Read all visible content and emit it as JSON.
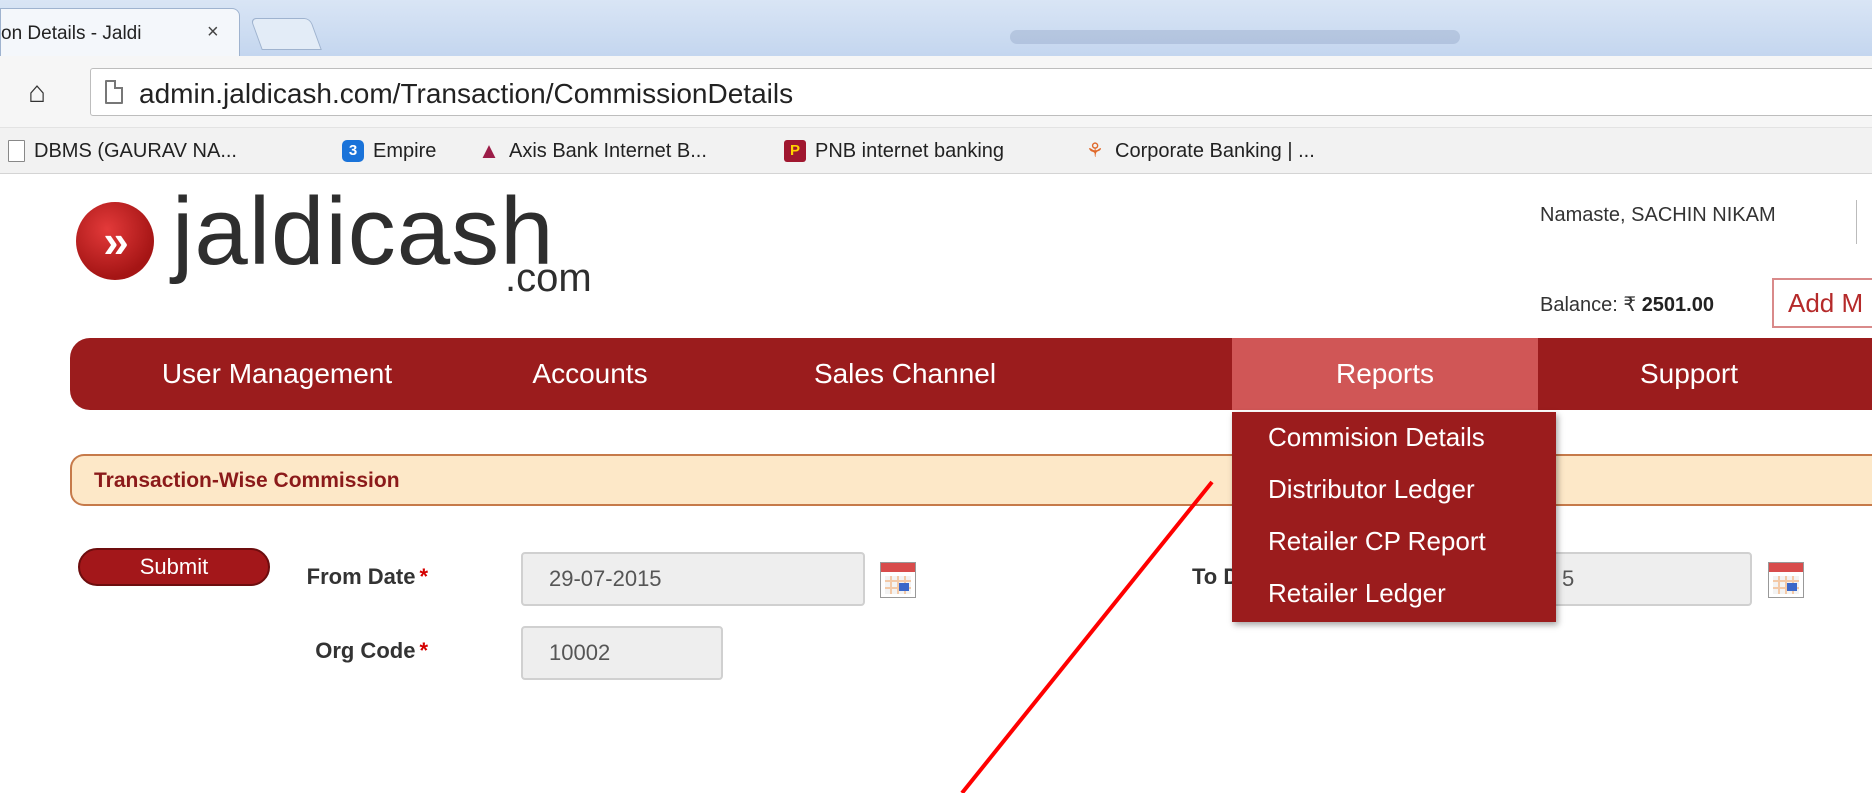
{
  "browser": {
    "tab_title": "on Details - Jaldi",
    "tab_close": "×",
    "url": "admin.jaldicash.com/Transaction/CommissionDetails",
    "bookmarks": [
      {
        "label": "DBMS (GAURAV NA...",
        "icon": "page-icon"
      },
      {
        "label": "Empire",
        "icon": "empire-icon",
        "glyph": "3"
      },
      {
        "label": "Axis Bank Internet B...",
        "icon": "axis-bank-icon",
        "glyph": "▲"
      },
      {
        "label": "PNB internet banking",
        "icon": "pnb-icon",
        "glyph": "P"
      },
      {
        "label": "Corporate Banking | ...",
        "icon": "icici-icon",
        "glyph": "⚘"
      }
    ]
  },
  "header": {
    "logo_text": "jaldicash",
    "logo_suffix": ".com",
    "logo_glyph": "»",
    "greeting": "Namaste, SACHIN NIKAM",
    "balance_label": "Balance: ₹",
    "balance_value": "2501.00",
    "add_money_label": "Add M"
  },
  "nav": {
    "items": [
      "User Management",
      "Accounts",
      "Sales Channel",
      "Reports",
      "Support"
    ],
    "active": "Reports",
    "reports_menu": [
      "Commision Details",
      "Distributor Ledger",
      "Retailer CP Report",
      "Retailer Ledger"
    ]
  },
  "form": {
    "section_title": "Transaction-Wise Commission",
    "from_date_label": "From Date",
    "from_date_value": "29-07-2015",
    "to_date_label": "To D",
    "to_date_value": "5",
    "org_code_label": "Org Code",
    "org_code_value": "10002",
    "required_mark": "*",
    "submit_label": "Submit"
  },
  "colors": {
    "nav_bg": "#9b1c1d",
    "nav_active": "#d05656",
    "section_bg": "#fde8c8",
    "annotation_line": "#ff0000"
  }
}
